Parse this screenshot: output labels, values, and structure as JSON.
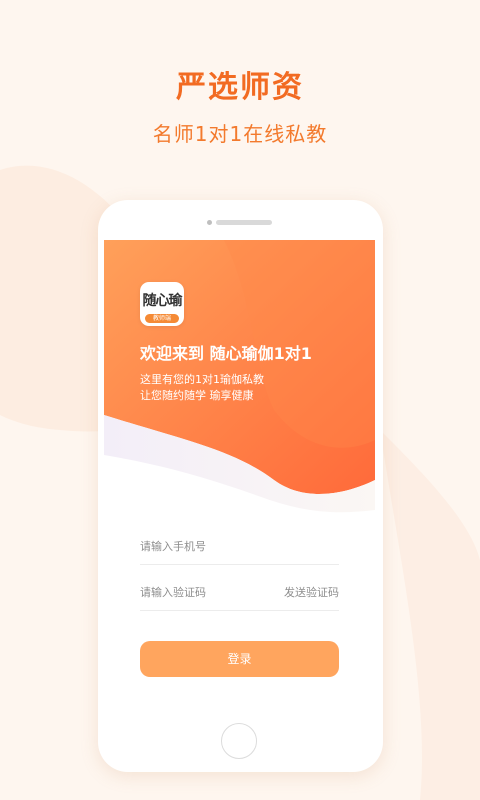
{
  "promo": {
    "headline": "严选师资",
    "subheadline": "名师1对1在线私教"
  },
  "app": {
    "logo_text": "随心瑜",
    "logo_badge": "教师端",
    "welcome": "欢迎来到 随心瑜伽1对1",
    "desc_line1": "这里有您的1对1瑜伽私教",
    "desc_line2": "让您随约随学 瑜享健康"
  },
  "form": {
    "phone_placeholder": "请输入手机号",
    "code_placeholder": "请输入验证码",
    "send_code_label": "发送验证码",
    "login_label": "登录"
  },
  "colors": {
    "accent": "#F26B22",
    "button": "#FFA55E",
    "header_gradient_start": "#FF9F55",
    "header_gradient_end": "#FF6B3A",
    "background": "#FEF6EF"
  }
}
